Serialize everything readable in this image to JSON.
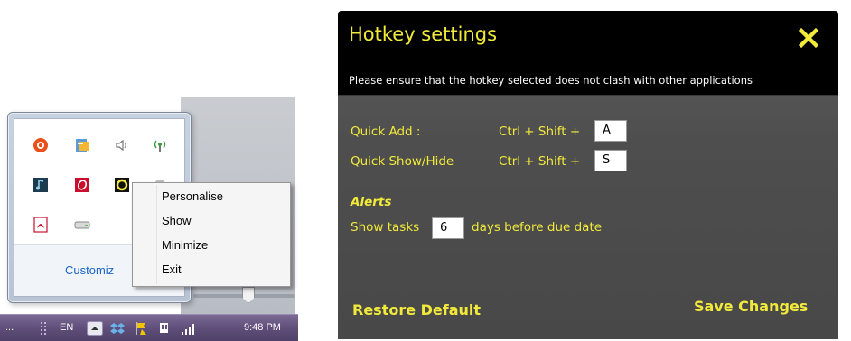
{
  "tray": {
    "customize_label": "Customiz",
    "context_menu": {
      "items": [
        {
          "label": "Personalise"
        },
        {
          "label": "Show"
        },
        {
          "label": "Minimize"
        },
        {
          "label": "Exit"
        }
      ]
    },
    "icons": [
      "orange-circle-app-icon",
      "blue-document-app-icon",
      "speaker-icon",
      "wifi-antenna-icon",
      "music-note-icon",
      "red-app-icon",
      "yellow-ring-app-icon",
      "gray-dot-icon",
      "pdf-icon",
      "drive-icon"
    ]
  },
  "taskbar": {
    "language": "EN",
    "clock": "9:48 PM",
    "overflow_dots": "..."
  },
  "dialog": {
    "title": "Hotkey settings",
    "subtitle": "Please ensure that the hotkey selected does not clash with other applications",
    "quick_add": {
      "label": "Quick Add :",
      "modifiers": "Ctrl + Shift +",
      "key": "A"
    },
    "quick_show_hide": {
      "label": "Quick Show/Hide",
      "modifiers": "Ctrl + Shift +",
      "key": "S"
    },
    "alerts": {
      "heading": "Alerts",
      "prefix": "Show tasks",
      "days": "6",
      "suffix": "days before due date"
    },
    "restore_label": "Restore Default",
    "save_label": "Save Changes"
  },
  "colors": {
    "accent_yellow": "#f2ea3a",
    "dialog_header": "#000000",
    "dialog_body": "#4e4e4e",
    "link_blue": "#1a64c8",
    "taskbar_purple": "#5f4f7a"
  }
}
